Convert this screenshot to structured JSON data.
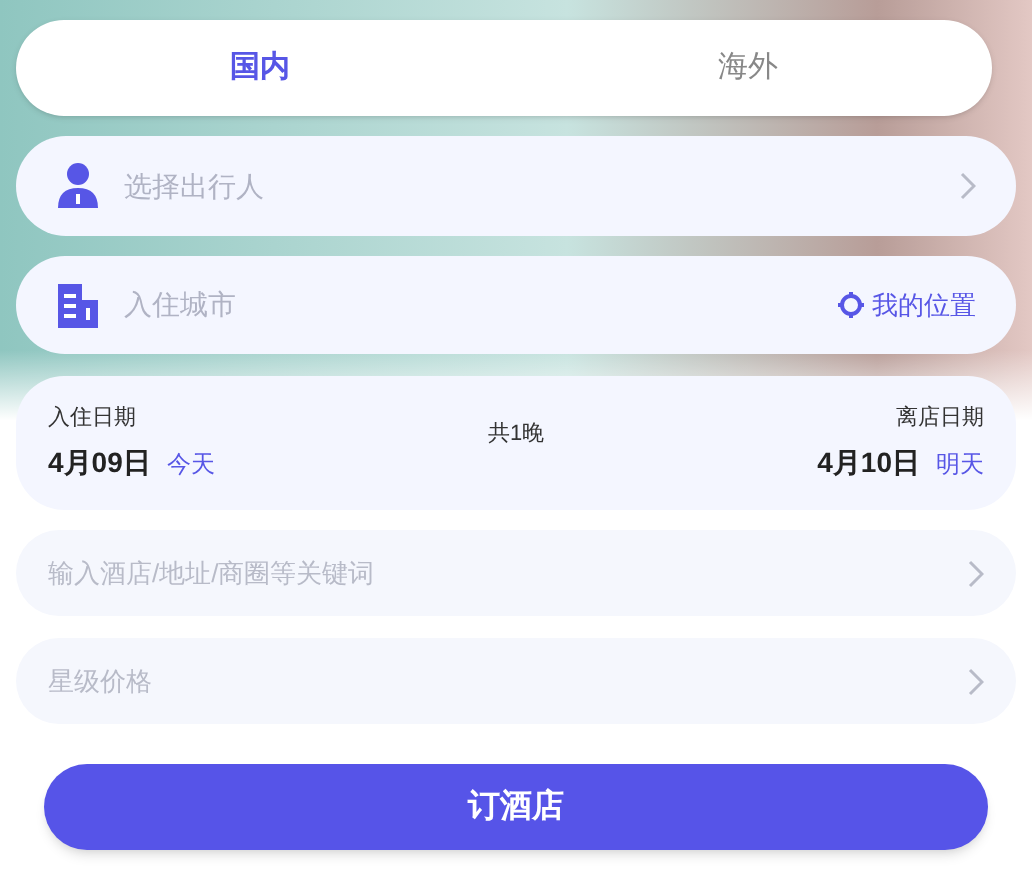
{
  "tabs": [
    {
      "label": "国内",
      "selected": true
    },
    {
      "label": "海外",
      "selected": false
    }
  ],
  "traveler": {
    "placeholder": "选择出行人"
  },
  "city": {
    "placeholder": "入住城市",
    "location_link": "我的位置"
  },
  "dates": {
    "checkin_label": "入住日期",
    "checkin_date": "4月09日",
    "checkin_day": "今天",
    "nights": "共1晚",
    "checkout_label": "离店日期",
    "checkout_date": "4月10日",
    "checkout_day": "明天"
  },
  "keyword": {
    "placeholder": "输入酒店/地址/商圈等关键词"
  },
  "star_price": {
    "placeholder": "星级价格"
  },
  "submit_button": "订酒店"
}
